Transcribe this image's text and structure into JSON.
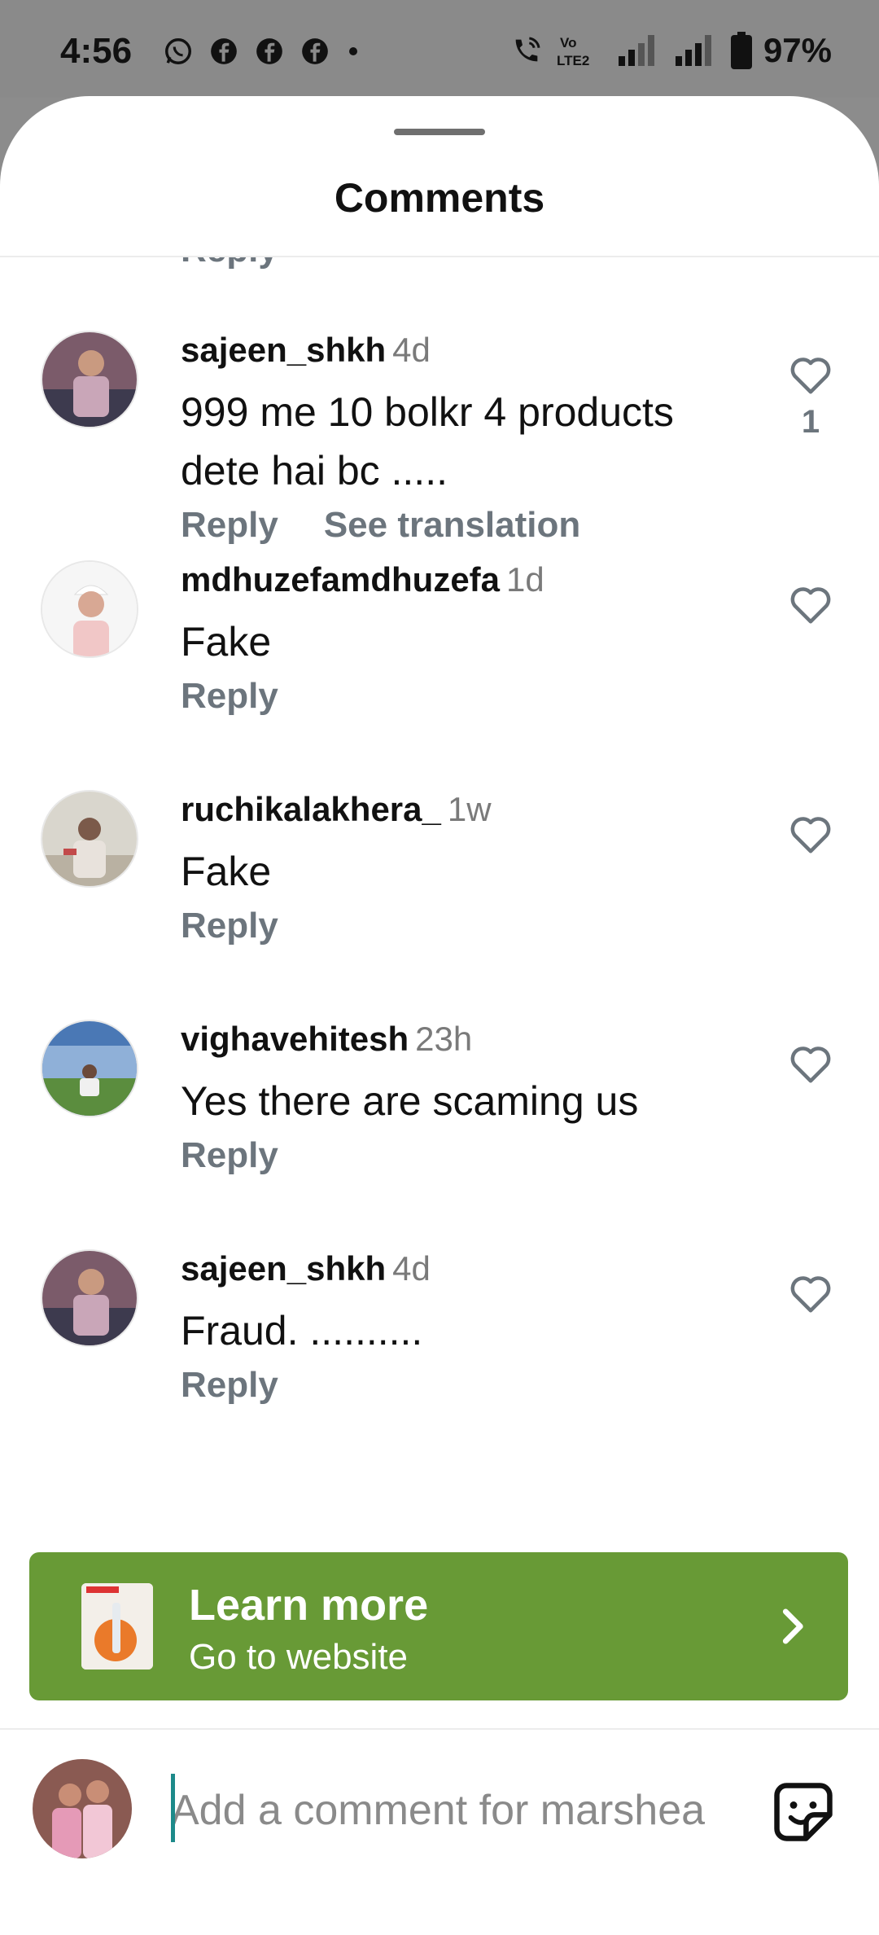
{
  "status_bar": {
    "time": "4:56",
    "battery": "97%",
    "network": "Vo LTE2",
    "left_icons": [
      "whatsapp-icon",
      "facebook-icon",
      "facebook-icon",
      "facebook-icon",
      "dot-icon"
    ]
  },
  "sheet": {
    "title": "Comments",
    "partial_reply_label": "Reply"
  },
  "comments": [
    {
      "username": "sajeen_shkh",
      "time": "4d",
      "text": "999 me 10 bolkr 4 products dete hai bc .....",
      "actions": [
        "Reply",
        "See translation"
      ],
      "likes": "1",
      "avatar_colors": [
        "#7b5b6a",
        "#c9a6b8",
        "#3d3a4e"
      ]
    },
    {
      "username": "mdhuzefamdhuzefa",
      "time": "1d",
      "text": "Fake",
      "actions": [
        "Reply"
      ],
      "likes": "",
      "avatar_colors": [
        "#f6f6f6",
        "#f1c7c7",
        "#d9a0a0"
      ]
    },
    {
      "username": "ruchikalakhera_",
      "time": "1w",
      "text": "Fake",
      "actions": [
        "Reply"
      ],
      "likes": "",
      "avatar_colors": [
        "#c9c2b3",
        "#e0ddd4",
        "#7b5a4a"
      ]
    },
    {
      "username": "vighavehitesh",
      "time": "23h",
      "text": "Yes there are scaming us",
      "actions": [
        "Reply"
      ],
      "likes": "",
      "avatar_colors": [
        "#4a78b5",
        "#5b8d3e",
        "#8fb0d8"
      ]
    },
    {
      "username": "sajeen_shkh",
      "time": "4d",
      "text": "Fraud. ..........",
      "actions": [
        "Reply"
      ],
      "likes": "",
      "avatar_colors": [
        "#7b5b6a",
        "#c9a6b8",
        "#3d3a4e"
      ]
    }
  ],
  "cta": {
    "title": "Learn more",
    "subtitle": "Go to website",
    "background": "#689a36"
  },
  "composer": {
    "placeholder": "Add a comment for marshea",
    "sticker_icon": "sticker-icon"
  }
}
